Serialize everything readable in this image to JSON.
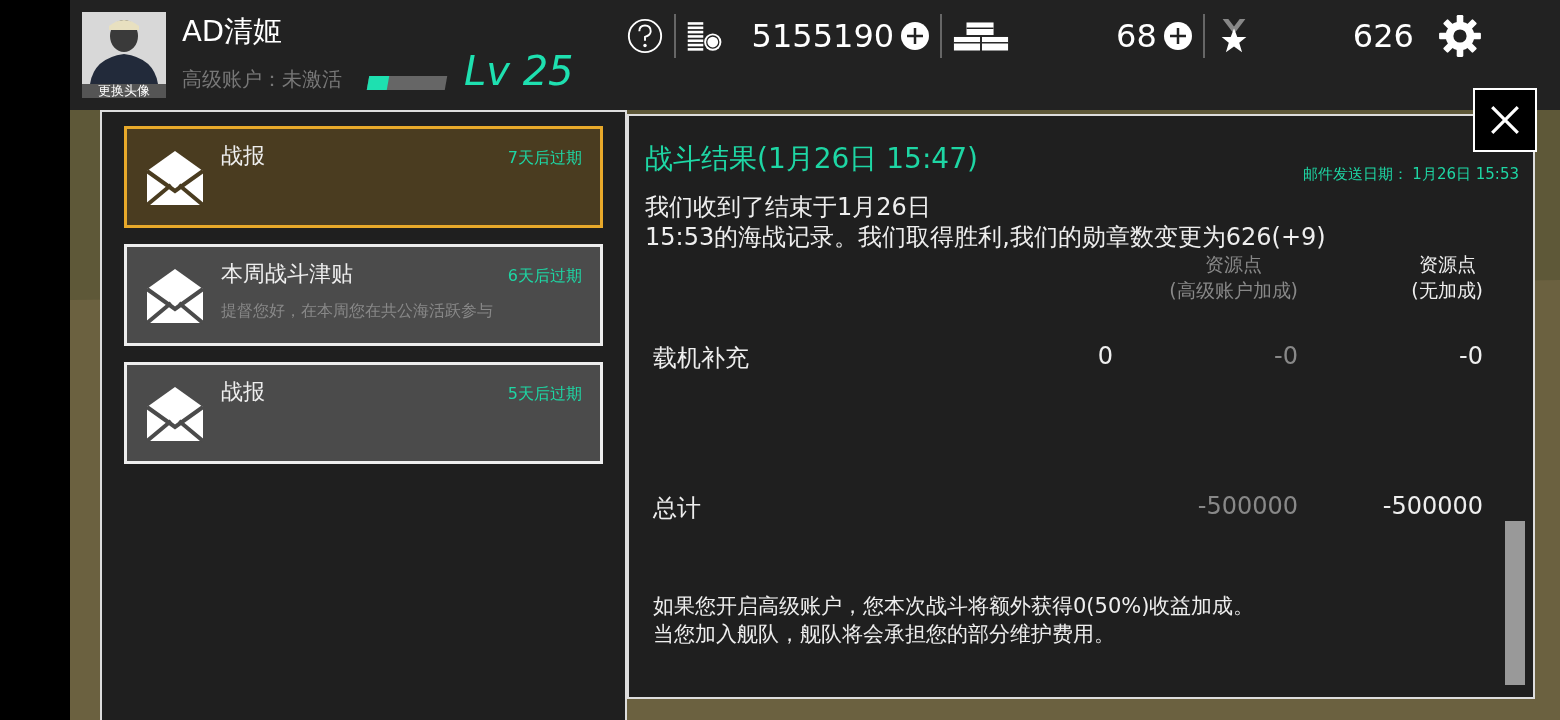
{
  "header": {
    "avatar_caption": "更换头像",
    "player_name": "AD清姬",
    "account_status": "高级账户：未激活",
    "xp": {
      "level": 0.25
    },
    "level_label": "Lv 25",
    "resources": [
      {
        "kind": "coins",
        "value": "5155190",
        "addable": true
      },
      {
        "kind": "crates",
        "value": "68",
        "addable": true
      },
      {
        "kind": "medals",
        "value": "626",
        "addable": false
      }
    ]
  },
  "mail_list": [
    {
      "title": "战报",
      "expiry": "7天后过期",
      "selected": true
    },
    {
      "title": "本周战斗津贴",
      "expiry": "6天后过期",
      "preview": "提督您好，在本周您在共公海活跃参与",
      "selected": false
    },
    {
      "title": "战报",
      "expiry": "5天后过期",
      "selected": false
    }
  ],
  "mail": {
    "title": "战斗结果(1月26日 15:47)",
    "sent_date": "邮件发送日期：  1月26日 15:53",
    "body": [
      "我们收到了结束于1月26日",
      "15:53的海战记录。我们取得胜利,我们的勋章数变更为626(+9)"
    ],
    "columns": [
      {
        "line_1": "资源点",
        "line_2": "(高级账户加成)",
        "muted": true
      },
      {
        "line_1": "资源点",
        "line_2": "(无加成)",
        "muted": false
      }
    ],
    "rows": [
      {
        "label": "载机补充",
        "column_1": "0",
        "column_2": "-0",
        "column_3": "-0"
      },
      {
        "label": "总计",
        "column_2": "-500000",
        "column_3": "-500000"
      }
    ],
    "footer": [
      "如果您开启高级账户，您本次战斗将额外获得0(50%)收益加成。",
      "当您加入舰队，舰队将会承担您的部分维护费用。"
    ]
  }
}
